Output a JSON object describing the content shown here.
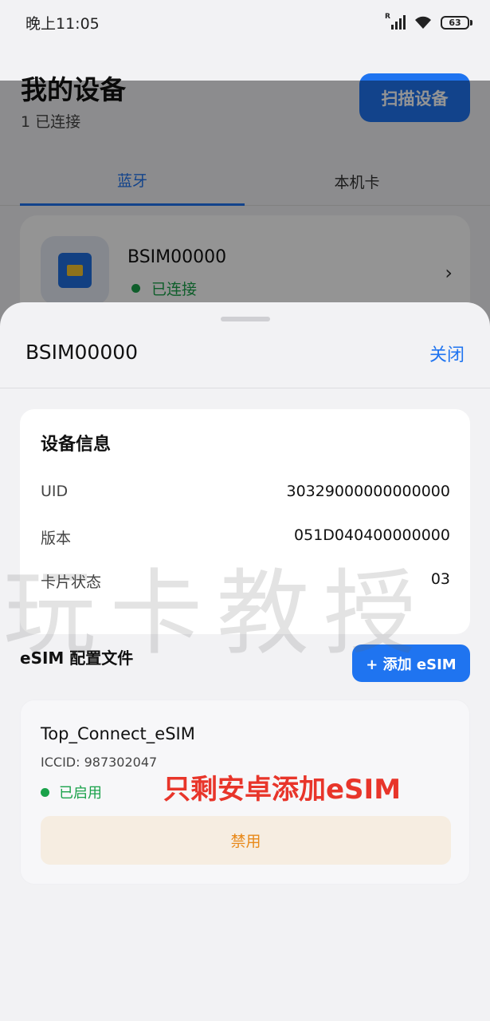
{
  "status_bar": {
    "time": "晚上11:05",
    "signal_letter": "R",
    "battery": "63"
  },
  "page": {
    "title": "我的设备",
    "subtitle": "1 已连接",
    "scan_label": "扫描设备",
    "tabs": [
      {
        "label": "蓝牙"
      },
      {
        "label": "本机卡"
      }
    ],
    "device": {
      "name": "BSIM00000",
      "status": "已连接"
    }
  },
  "sheet": {
    "title": "BSIM00000",
    "close_label": "关闭",
    "info": {
      "heading": "设备信息",
      "rows": [
        {
          "key": "UID",
          "value": "30329000000000000"
        },
        {
          "key": "版本",
          "value": "051D040400000000"
        },
        {
          "key": "卡片状态",
          "value": "03"
        }
      ]
    },
    "esim": {
      "heading": "eSIM 配置文件",
      "add_label": "+ 添加 eSIM",
      "profile": {
        "name": "Top_Connect_eSIM",
        "iccid": "ICCID: 987302047",
        "status": "已启用",
        "disable_label": "禁用"
      }
    }
  },
  "watermark": "玩卡教授",
  "annotation": "只剩安卓添加eSIM"
}
